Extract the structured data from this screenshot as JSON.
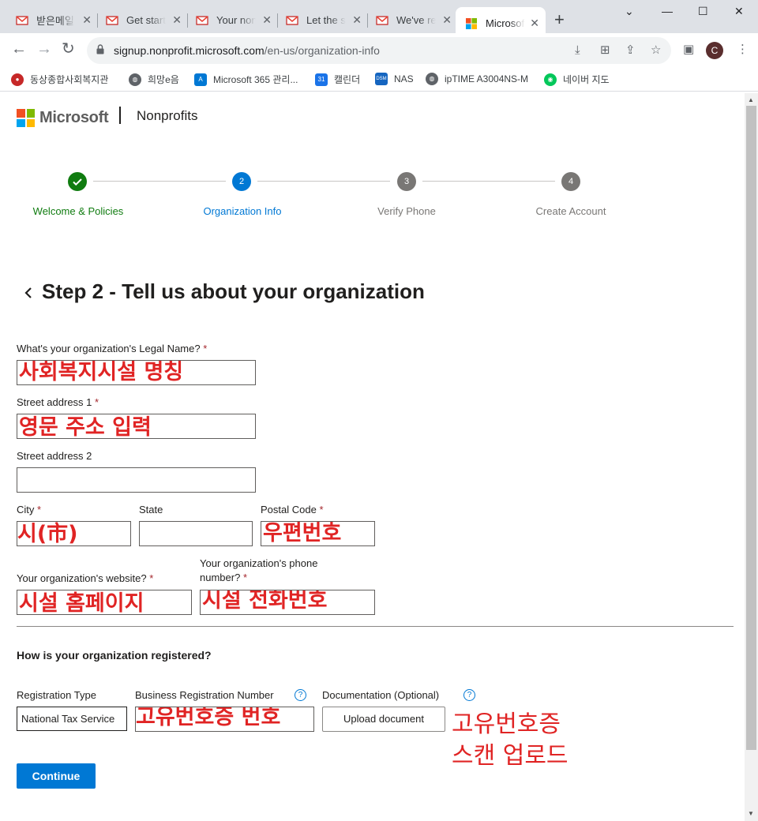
{
  "browser": {
    "tabs": [
      {
        "label": "받은메일",
        "icon": "gmail-icon"
      },
      {
        "label": "Get start",
        "icon": "gmail-icon"
      },
      {
        "label": "Your non",
        "icon": "gmail-icon"
      },
      {
        "label": "Let the s",
        "icon": "gmail-icon"
      },
      {
        "label": "We've re",
        "icon": "gmail-icon"
      },
      {
        "label": "Microsoft",
        "icon": "microsoft-icon",
        "active": true
      }
    ],
    "url_host": "signup.nonprofit.microsoft.com",
    "url_path": "/en-us/organization-info",
    "profile_initial": "C",
    "bookmarks": [
      {
        "label": "동상종합사회복지관",
        "icon": "bookmark-org-icon",
        "color": "#c62828"
      },
      {
        "label": "희망e음",
        "icon": "globe-icon",
        "color": "#5f6368"
      },
      {
        "label": "Microsoft 365 관리...",
        "icon": "m365-admin-icon",
        "color": "#0078d4"
      },
      {
        "label": "캘린더",
        "icon": "calendar-icon",
        "color": "#1a73e8"
      },
      {
        "label": "NAS",
        "icon": "dsm-icon",
        "color": "#1565c0"
      },
      {
        "label": "ipTIME A3004NS-M",
        "icon": "globe-icon",
        "color": "#5f6368"
      },
      {
        "label": "네이버 지도",
        "icon": "naver-map-icon",
        "color": "#03c75a"
      }
    ]
  },
  "header": {
    "brand": "Microsoft",
    "product": "Nonprofits"
  },
  "steps": [
    {
      "number": "✓",
      "label": "Welcome & Policies",
      "state": "done",
      "color": "#107c10"
    },
    {
      "number": "2",
      "label": "Organization Info",
      "state": "current",
      "color": "#0078d4"
    },
    {
      "number": "3",
      "label": "Verify Phone",
      "state": "pending",
      "color": "#797775"
    },
    {
      "number": "4",
      "label": "Create Account",
      "state": "pending",
      "color": "#797775"
    }
  ],
  "form": {
    "title": "Step 2 - Tell us about your organization",
    "legal_name": {
      "label": "What's your organization's Legal Name?",
      "required": "*",
      "annotation": "사회복지시설 명칭"
    },
    "street1": {
      "label": "Street address 1",
      "required": "*",
      "annotation": "영문 주소 입력"
    },
    "street2": {
      "label": "Street address 2"
    },
    "city": {
      "label": "City",
      "required": "*",
      "annotation": "시(市)"
    },
    "state": {
      "label": "State"
    },
    "postal": {
      "label": "Postal Code",
      "required": "*",
      "annotation": "우편번호"
    },
    "website": {
      "label": "Your organization's website?",
      "required": "*",
      "annotation": "시설 홈페이지"
    },
    "phone": {
      "label_line1": "Your organization's phone",
      "label_line2": "number?",
      "required": "*",
      "annotation": "시설 전화번호"
    },
    "registration_heading": "How is your organization registered?",
    "registration_type": {
      "label": "Registration Type",
      "value": "National Tax Service"
    },
    "business_number": {
      "label": "Business Registration Number",
      "help": "?",
      "annotation": "고유번호증 번호"
    },
    "documentation": {
      "label": "Documentation (Optional)",
      "help": "?",
      "button": "Upload document",
      "annotation_line1": "고유번호증",
      "annotation_line2": "스캔 업로드"
    },
    "continue_label": "Continue"
  },
  "colors": {
    "accent": "#0078d4",
    "success": "#107c10",
    "annotation": "#e02424",
    "required": "#a4262c"
  }
}
